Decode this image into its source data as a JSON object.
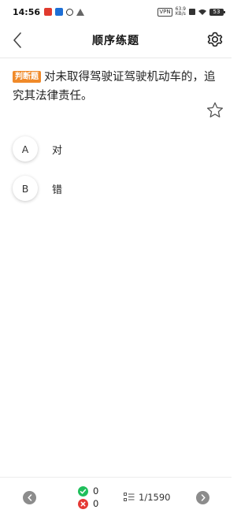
{
  "status_bar": {
    "time": "14:56",
    "vpn": "VPN",
    "net_speed_top": "63.9",
    "net_speed_bottom": "KB/s",
    "battery": "53"
  },
  "nav": {
    "title": "顺序练题"
  },
  "question": {
    "type_label": "判断题",
    "text": "对未取得驾驶证驾驶机动车的，追究其法律责任。"
  },
  "options": [
    {
      "key": "A",
      "text": "对"
    },
    {
      "key": "B",
      "text": "错"
    }
  ],
  "bottom_bar": {
    "correct_count": "0",
    "wrong_count": "0",
    "progress": "1/1590"
  },
  "colors": {
    "badge": "#f08a2a",
    "correct": "#1fbf5b",
    "wrong": "#e53935",
    "arrow_button": "#8c8c8c"
  }
}
